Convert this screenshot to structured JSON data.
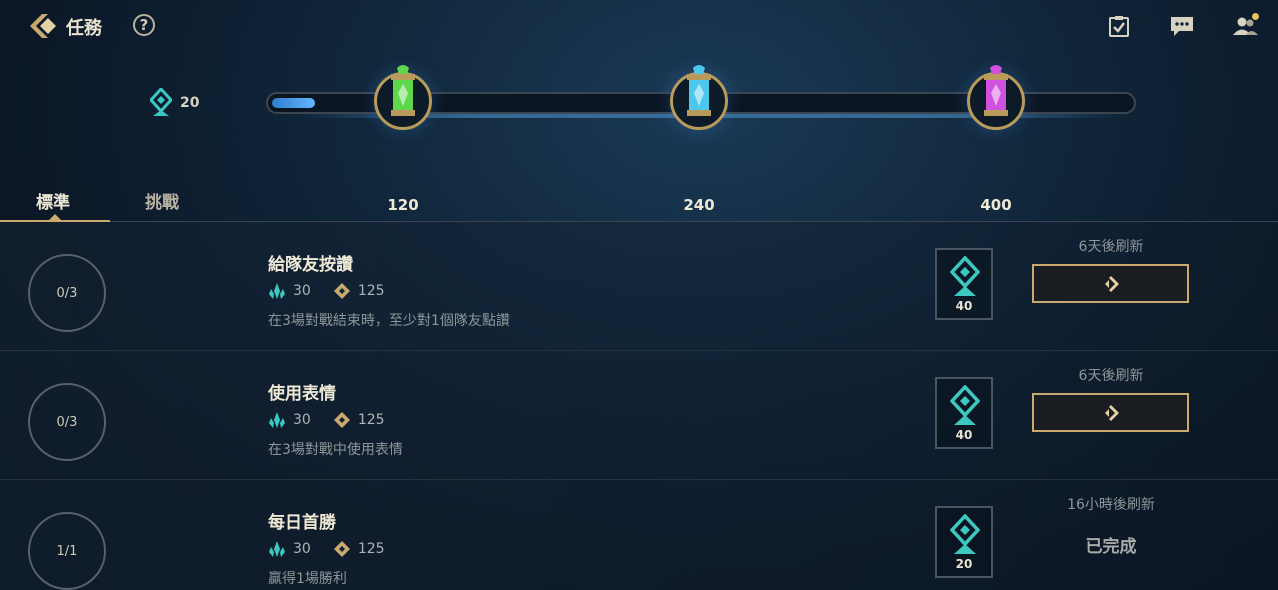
{
  "header": {
    "title": "任務",
    "help_symbol": "?",
    "icons": [
      "back-chevron-icon",
      "help-icon",
      "quest-clipboard-icon",
      "chat-icon",
      "friends-icon"
    ]
  },
  "progress": {
    "current_xp": "20",
    "max_xp": 400,
    "fill_fraction": 0.05,
    "milestones": [
      {
        "label": "120",
        "capsule_color": "#5ed84a"
      },
      {
        "label": "240",
        "capsule_color": "#4cc8ee"
      },
      {
        "label": "400",
        "capsule_color": "#d050e0"
      }
    ]
  },
  "tabs": [
    {
      "label": "標準",
      "active": true
    },
    {
      "label": "挑戰",
      "active": false
    }
  ],
  "quests": [
    {
      "progress": "0/3",
      "title": "給隊友按讚",
      "reward_xp": "30",
      "reward_coins": "125",
      "description": "在3場對戰結束時，至少對1個隊友點讚",
      "reward_box_value": "40",
      "refresh_text": "6天後刷新",
      "status": "go"
    },
    {
      "progress": "0/3",
      "title": "使用表情",
      "reward_xp": "30",
      "reward_coins": "125",
      "description": "在3場對戰中使用表情",
      "reward_box_value": "40",
      "refresh_text": "6天後刷新",
      "status": "go"
    },
    {
      "progress": "1/1",
      "title": "每日首勝",
      "reward_xp": "30",
      "reward_coins": "125",
      "description": "贏得1場勝利",
      "reward_box_value": "20",
      "refresh_text": "16小時後刷新",
      "status": "已完成"
    }
  ],
  "colors": {
    "gold": "#c8aa6e",
    "teal": "#3cc8c0",
    "background": "#0f2235"
  }
}
